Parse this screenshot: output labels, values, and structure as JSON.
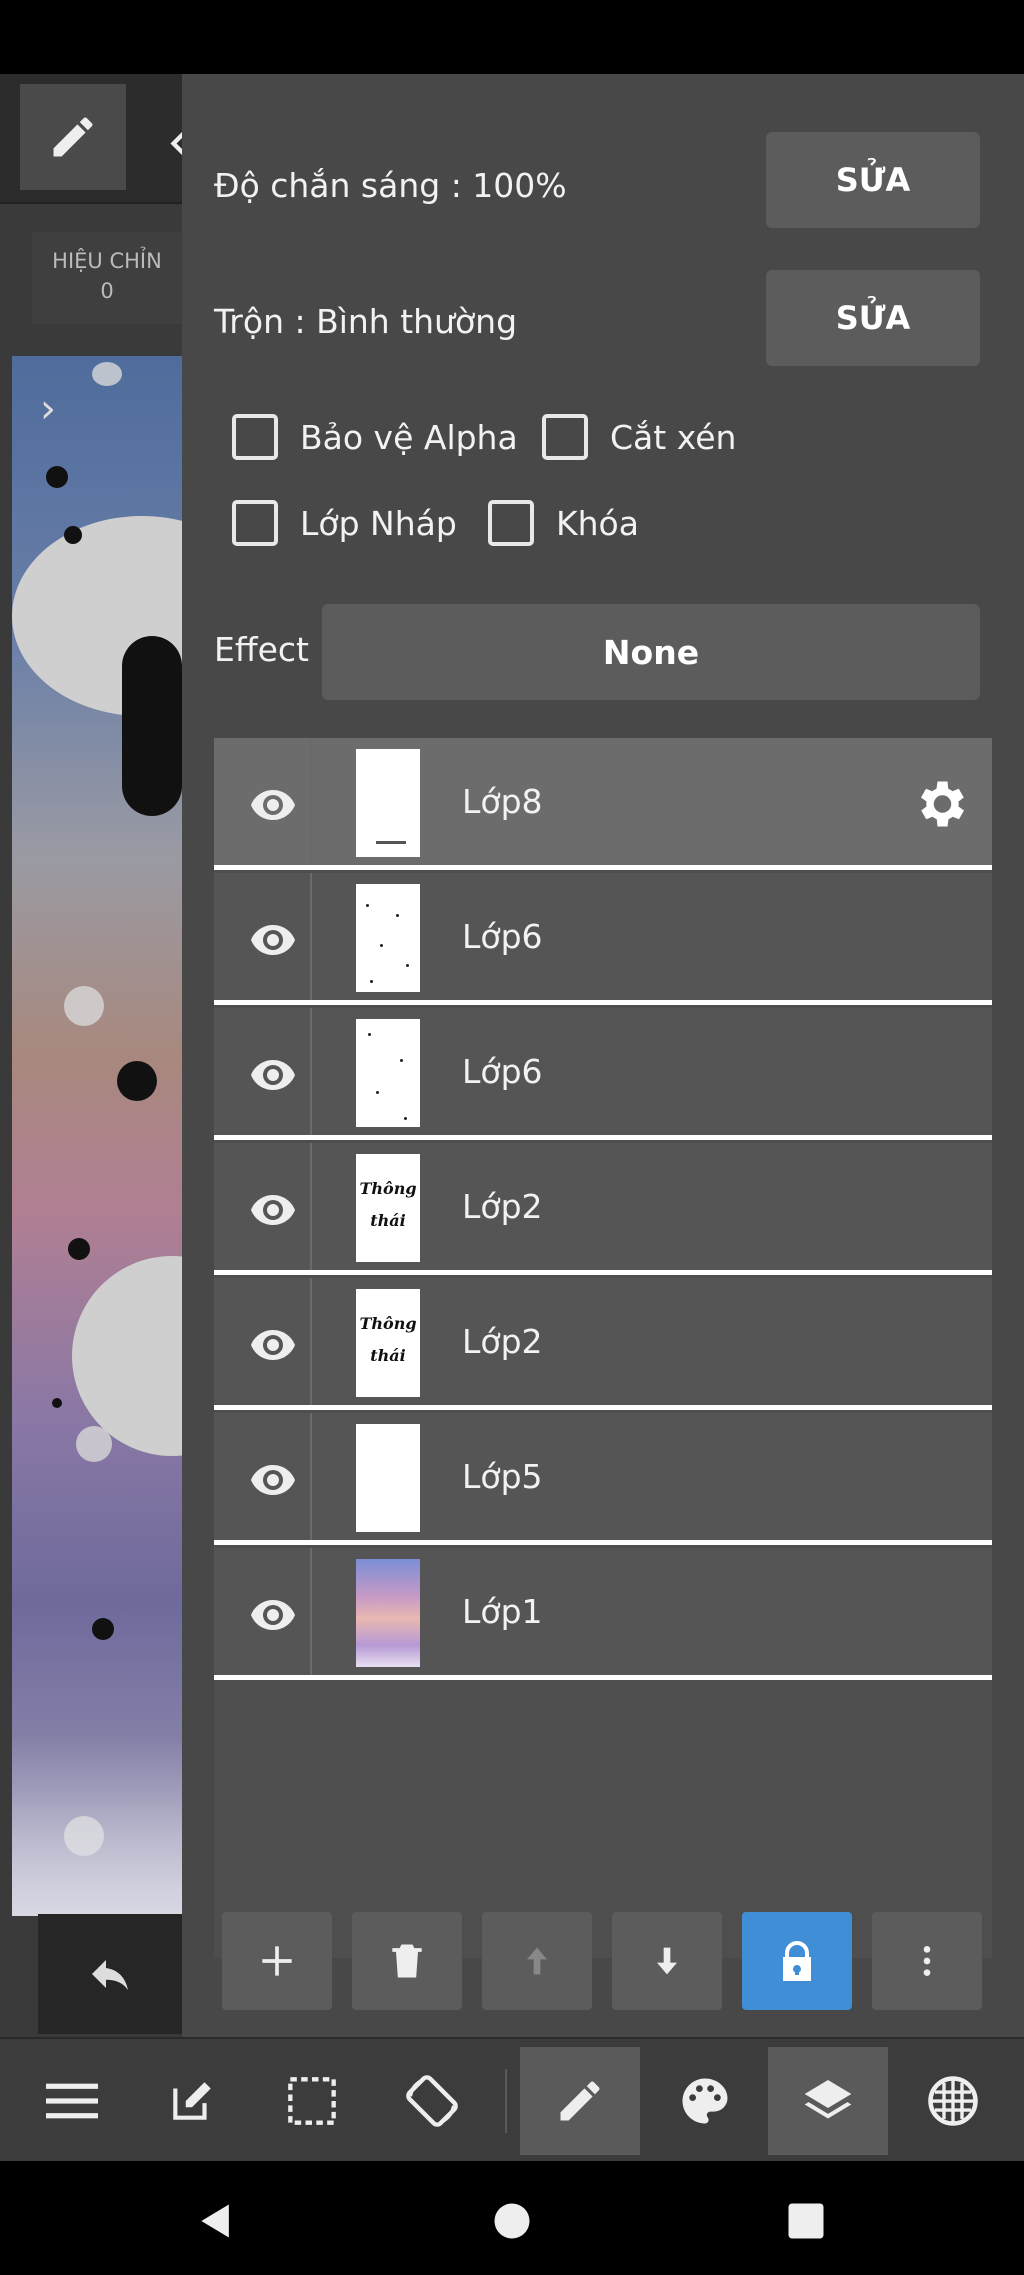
{
  "correction": {
    "label": "HIỆU CHỈN",
    "value": "0"
  },
  "properties": {
    "opacity_label": "Độ chắn sáng : 100%",
    "blend_label": "Trộn : Bình thường",
    "edit_label": "SỬA"
  },
  "options": {
    "protect_alpha": "Bảo vệ Alpha",
    "clipping": "Cắt xén",
    "draft_layer": "Lớp Nháp",
    "lock": "Khóa"
  },
  "effect": {
    "label": "Effect",
    "value": "None"
  },
  "layers": [
    {
      "name": "Lớp8",
      "selected": true,
      "thumb": "white-sign"
    },
    {
      "name": "Lớp6",
      "selected": false,
      "thumb": "white-dots"
    },
    {
      "name": "Lớp6",
      "selected": false,
      "thumb": "white-dots"
    },
    {
      "name": "Lớp2",
      "selected": false,
      "thumb": "text"
    },
    {
      "name": "Lớp2",
      "selected": false,
      "thumb": "text"
    },
    {
      "name": "Lớp5",
      "selected": false,
      "thumb": "white"
    },
    {
      "name": "Lớp1",
      "selected": false,
      "thumb": "gradient"
    }
  ],
  "thumb_text": [
    "Thông",
    "thái"
  ],
  "colors": {
    "panel_bg": "#484848",
    "button_bg": "#5c5c5c",
    "selected_row": "#6c6c6c",
    "active_blue": "#3f8ed6"
  },
  "icons": {
    "layer_actions": [
      "plus-icon",
      "trash-icon",
      "arrow-up-icon",
      "arrow-down-icon",
      "lock-icon",
      "more-vert-icon"
    ],
    "main_toolbar": [
      "menu-icon",
      "edit-icon",
      "selection-icon",
      "rotate-icon",
      "pen-icon",
      "palette-icon",
      "layers-icon",
      "grid-icon"
    ],
    "nav": [
      "back-icon",
      "home-icon",
      "recents-icon"
    ]
  }
}
